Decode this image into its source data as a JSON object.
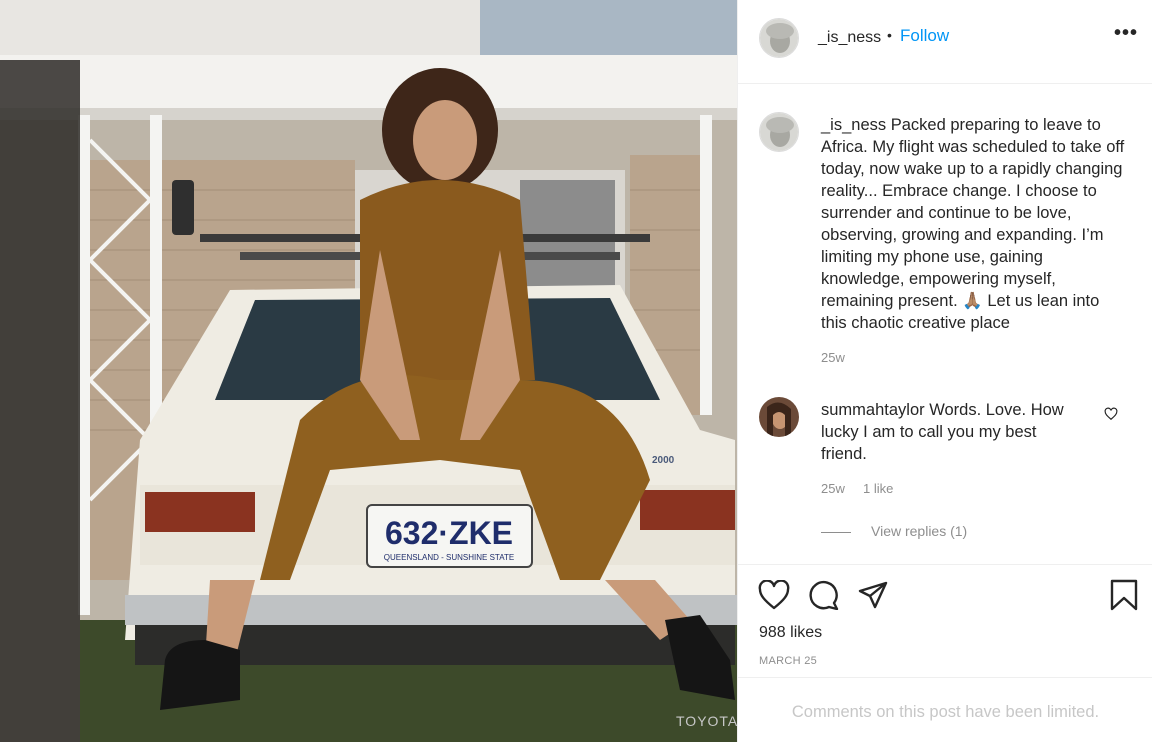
{
  "post": {
    "username": "_is_ness",
    "dot": "•",
    "follow_label": "Follow",
    "more_label": "•••",
    "caption_text": "Packed preparing to leave to Africa. My flight was scheduled to take off today, now wake up to a rapidly changing reality... Embrace change. I choose to surrender and continue to be love, observing, growing and expanding. I’m limiting my phone use, gaining knowledge, empowering myself, remaining present. 🙏🏽 Let us lean into this chaotic creative place",
    "caption_time": "25w",
    "likes": "988 likes",
    "date": "MARCH 25",
    "comments_limited": "Comments on this post have been limited."
  },
  "comment": {
    "username": "summahtaylor",
    "text": "Words. Love. How lucky I am to call you my best friend.",
    "time": "25w",
    "likes": "1 like",
    "view_replies": "View replies (1)"
  },
  "photo": {
    "license_plate": "632·ZKE",
    "plate_state": "QUEENSLAND - SUNSHINE STATE",
    "car_badge": "TOYOTA",
    "model_badge": "2000"
  },
  "icons": [
    "heart-icon",
    "comment-icon",
    "share-icon",
    "bookmark-icon",
    "more-options-icon"
  ],
  "colors": {
    "follow": "#0095f6",
    "muted": "#8e8e8e",
    "limited": "#c7c7c7",
    "text": "#262626"
  }
}
